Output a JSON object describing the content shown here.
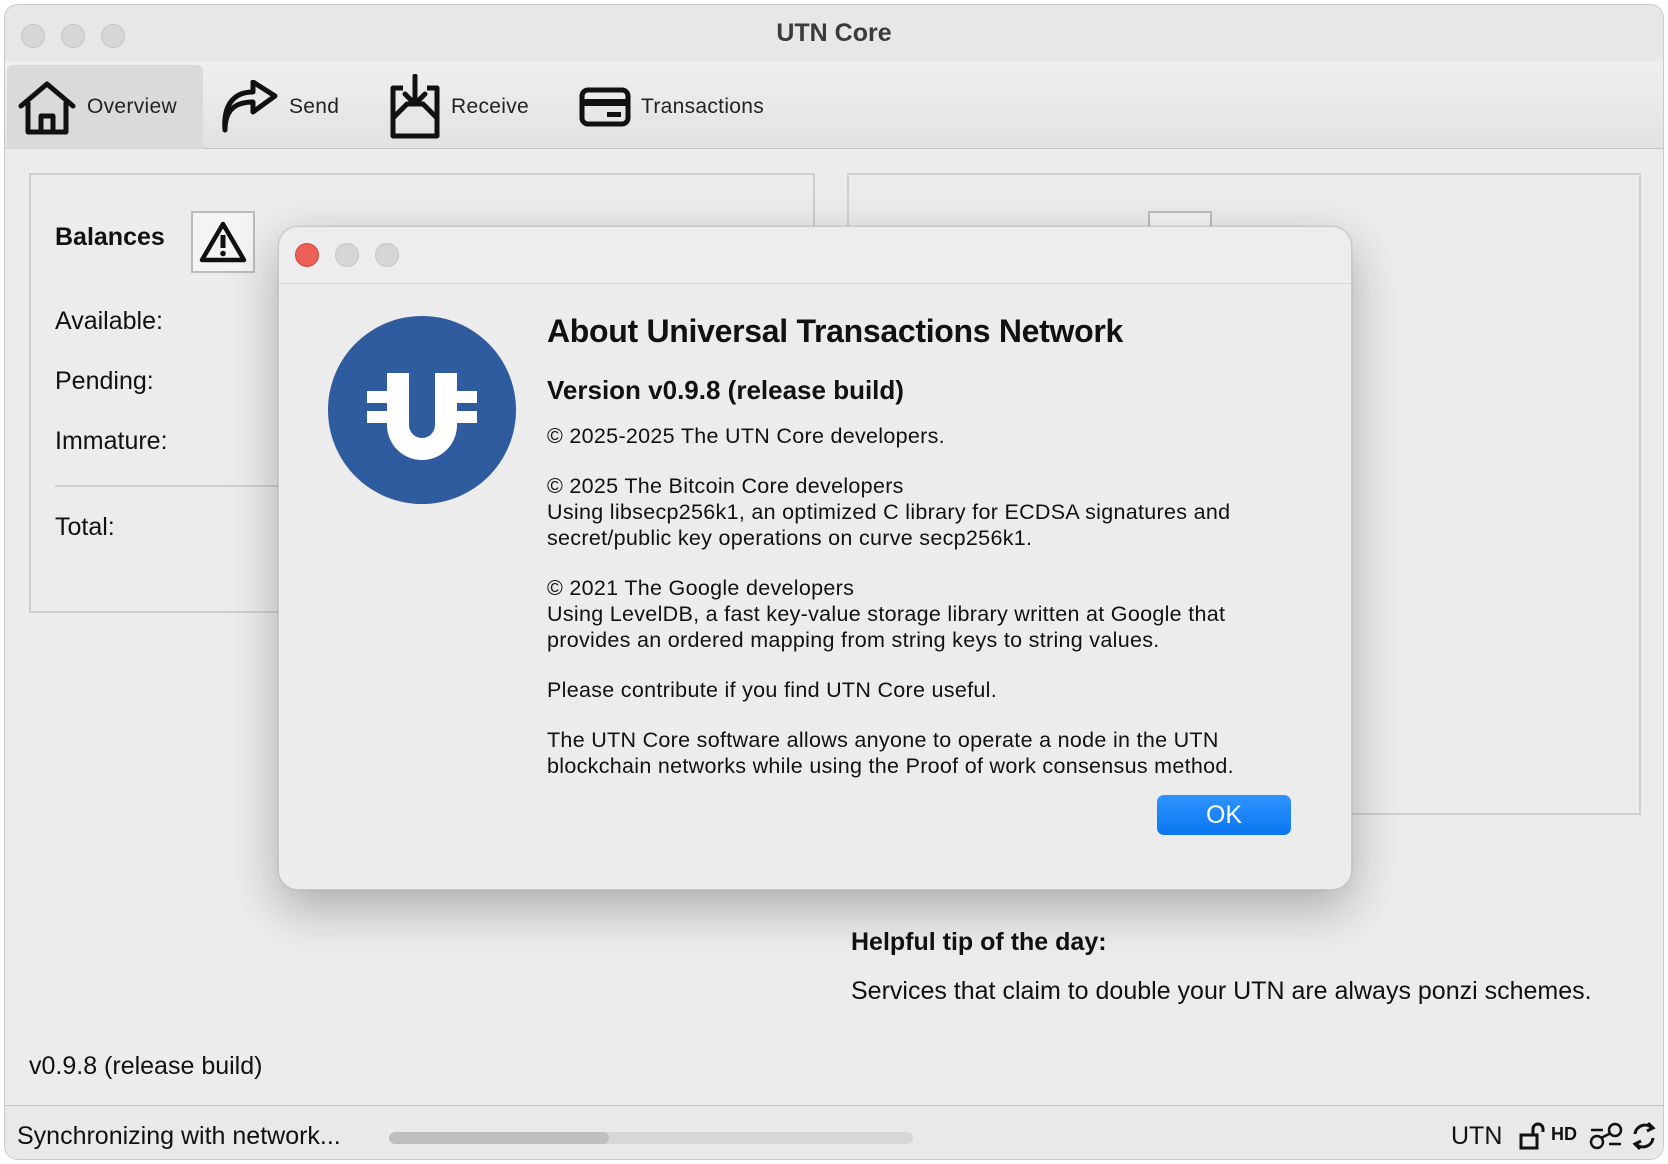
{
  "window": {
    "title": "UTN Core"
  },
  "toolbar": {
    "tabs": [
      {
        "label": "Overview",
        "icon": "home-icon",
        "active": true
      },
      {
        "label": "Send",
        "icon": "send-arrow-icon"
      },
      {
        "label": "Receive",
        "icon": "receive-tray-icon"
      },
      {
        "label": "Transactions",
        "icon": "card-icon"
      }
    ]
  },
  "overview": {
    "balances_title": "Balances",
    "labels": {
      "available": "Available:",
      "pending": "Pending:",
      "immature": "Immature:",
      "total": "Total:"
    },
    "tip_title": "Helpful tip of the day:",
    "tip_text": "Services that claim to double your UTN are always ponzi schemes.",
    "version": "v0.9.8 (release build)"
  },
  "status": {
    "text": "Synchronizing with network...",
    "progress_fraction": 0.42,
    "unit": "UTN",
    "hd": "HD",
    "icons": [
      "lock-open-icon",
      "hd-icon",
      "network-icon",
      "sync-icon"
    ]
  },
  "dialog": {
    "title": "About Universal Transactions Network",
    "version": "Version v0.9.8 (release build)",
    "paragraphs": [
      "© 2025-2025 The UTN Core developers.",
      "© 2025 The Bitcoin Core developers\nUsing libsecp256k1, an optimized C library for ECDSA signatures and secret/public key operations on curve secp256k1.",
      "© 2021 The Google developers\nUsing LevelDB, a fast key-value storage library written at Google that provides an ordered mapping from string keys to string values.",
      "Please contribute if you find UTN Core useful.",
      "The UTN Core software allows anyone to operate a node in the UTN blockchain networks while using the Proof of work consensus method."
    ],
    "ok_label": "OK",
    "logo_text": "U",
    "colors": {
      "logo_blue": "#2f5c9e",
      "ok_blue": "#0a77f0",
      "close_red": "#ec5f57"
    }
  }
}
